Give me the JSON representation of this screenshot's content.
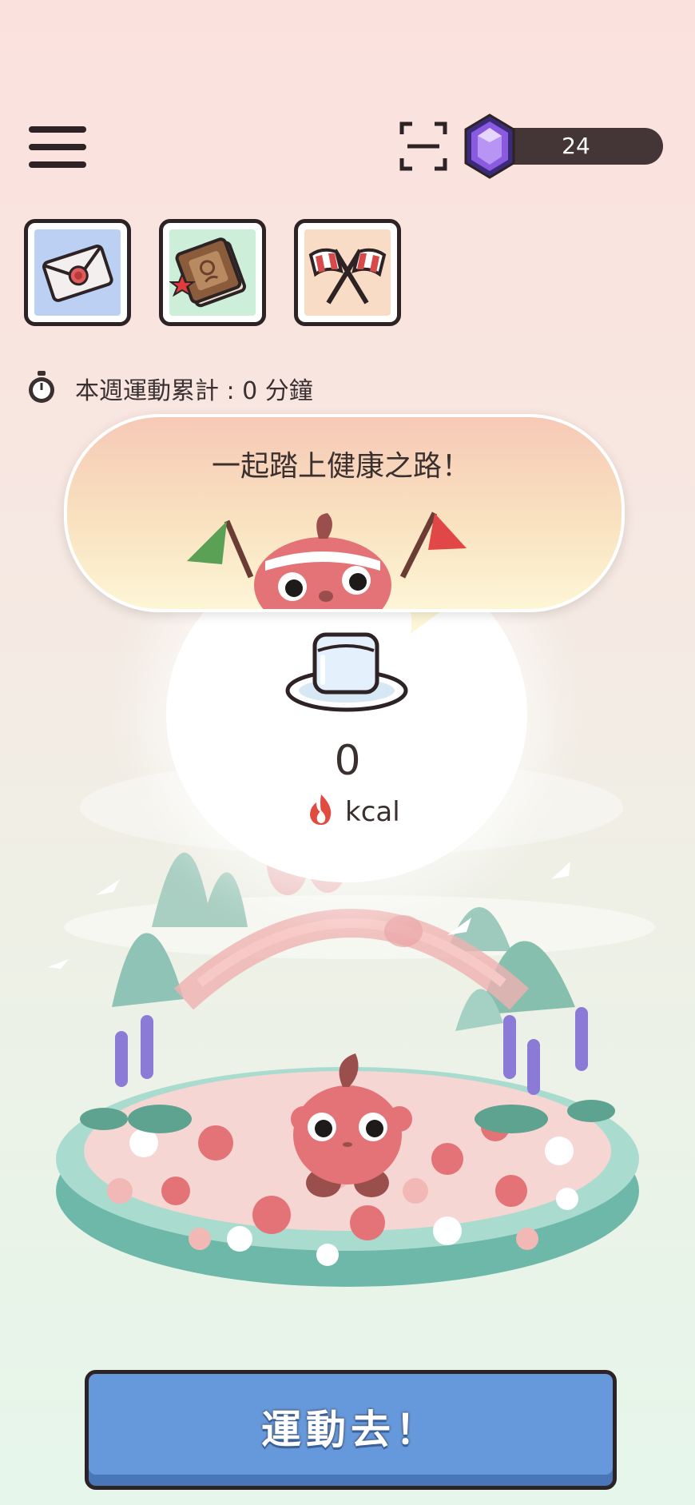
{
  "header": {
    "menu_icon": "hamburger-menu-icon",
    "scan_icon": "scan-frame-icon",
    "gem_icon": "purple-gem-icon",
    "gem_count": "24"
  },
  "shortcuts": [
    {
      "icon": "mail-envelope-icon",
      "bg": "#bcd0f4"
    },
    {
      "icon": "journal-book-icon",
      "bg": "#cdeed9"
    },
    {
      "icon": "crossed-flags-icon",
      "bg": "#f8dcc6"
    }
  ],
  "weekly": {
    "icon": "stopwatch-icon",
    "label": "本週運動累計 : 0 分鐘"
  },
  "speech_bubble": {
    "text": "一起踏上健康之路！"
  },
  "calories": {
    "icon": "melting-ice-cube-icon",
    "value": "0",
    "flame_icon": "flame-icon",
    "unit": "kcal"
  },
  "cta": {
    "label": "運動去！",
    "color": "#6699db"
  },
  "colors": {
    "outline": "#2d2224",
    "accent_red": "#e47377",
    "teal": "#7ec2b4"
  }
}
